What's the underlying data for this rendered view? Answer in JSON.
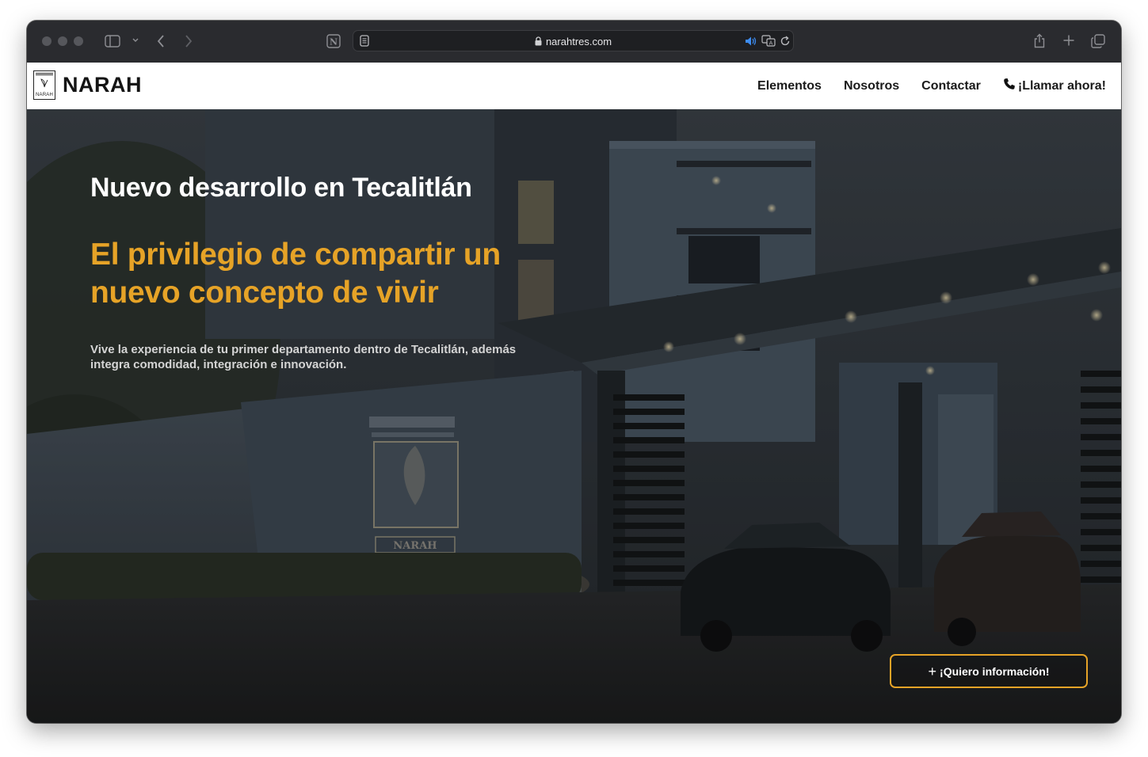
{
  "browser": {
    "url": "narahtres.com",
    "icons": [
      "sidebar-icon",
      "chevron-down-icon",
      "back-icon",
      "forward-icon",
      "notion-icon",
      "reader-icon",
      "lock-icon",
      "audio-icon",
      "translate-icon",
      "reload-icon",
      "share-icon",
      "new-tab-icon",
      "tabs-overview-icon"
    ]
  },
  "site": {
    "brand": "NARAH",
    "logo_small_text": "NARAH",
    "nav": {
      "elementos": "Elementos",
      "nosotros": "Nosotros",
      "contactar": "Contactar",
      "llamar": "¡Llamar ahora!"
    }
  },
  "hero": {
    "kicker": "Nuevo desarrollo en Tecalitlán",
    "headline": "El privilegio de compartir un nuevo concepto de vivir",
    "description": "Vive la experiencia de tu primer departamento dentro de Tecalitlán, además integra comodidad, integración e innovación.",
    "cta": "¡Quiero información!",
    "sign_text": "NARAH"
  },
  "colors": {
    "accent": "#e6a327",
    "toolbar": "#2a2b2f",
    "nav_bg": "#ffffff"
  }
}
